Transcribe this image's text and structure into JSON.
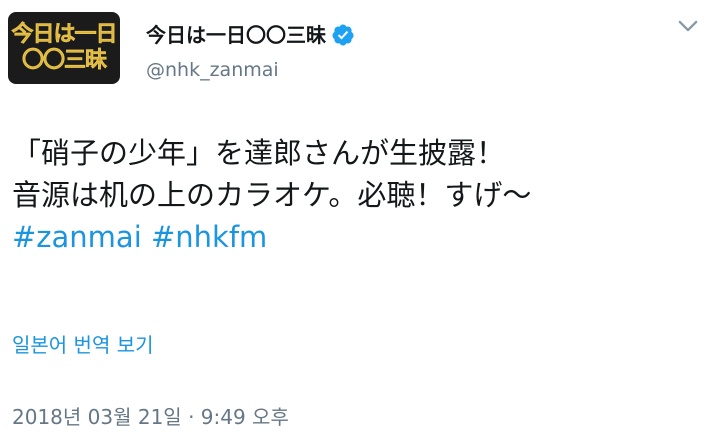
{
  "profile": {
    "avatar_line1": "今日は一日",
    "avatar_line2": "〇〇三昧",
    "display_name": "今日は一日〇〇三昧",
    "handle": "@nhk_zanmai",
    "verified_icon": "verified-badge-icon",
    "badge_color": "#1da1f2"
  },
  "menu": {
    "icon": "chevron-down-icon"
  },
  "tweet": {
    "line1": "「硝子の少年」を達郎さんが生披露！",
    "line2": "音源は机の上のカラオケ。必聴！すげ〜",
    "hashtags": [
      "#zanmai",
      "#nhkfm"
    ],
    "link_color": "#1b95e0"
  },
  "translate_label": "일본어 번역 보기",
  "timestamp": "2018년 03월 21일 · 9:49 오후"
}
